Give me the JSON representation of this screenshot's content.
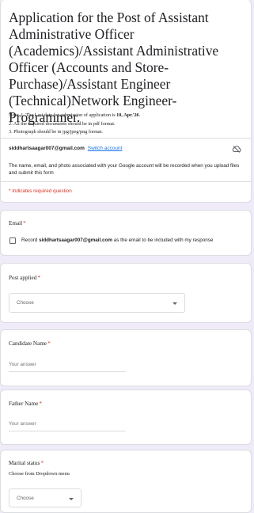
{
  "form": {
    "title": "Application for the Post of Assistant Administrative Officer (Academics)/Assistant Administrative Officer (Accounts and Store-Purchase)/Assistant Engineer (Technical)Network Engineer-Programmer.",
    "note_prefix": "Note: 1. The Last date for submission of application is ",
    "note_date": "10, Apr.'26",
    "note_suffix": ".",
    "note_2": "2. All the required documents should be in pdf format.",
    "note_3": "3. Photograph should be in jpg/jpeg/png format.",
    "account_email": "siddhartsaagar007@gmail.com",
    "switch_account": "Switch account",
    "privacy_text": "The name, email, and photo associated with your Google account will be recorded when you upload files and submit this form",
    "required_note": "* Indicates required question"
  },
  "email_question": {
    "label": "Email",
    "required_mark": "*",
    "record_prefix": "Record ",
    "record_email": "siddhartsaagar007@gmail.com",
    "record_suffix": " as the email to be included with my response"
  },
  "post_applied": {
    "label": "Post applied",
    "required_mark": "*",
    "selected": "Choose"
  },
  "candidate_name": {
    "label": "Candidate Name",
    "required_mark": "*",
    "placeholder": "Your answer"
  },
  "father_name": {
    "label": "Father Name",
    "required_mark": "*",
    "placeholder": "Your answer"
  },
  "marital_status": {
    "label": "Marital status",
    "required_mark": "*",
    "helper": "Choose from Dropdown menu",
    "selected": "Choose"
  },
  "icons": {
    "cloud": "cloud-not-saved-icon",
    "caret": "chevron-down-icon"
  },
  "colors": {
    "background": "#f0ebf8",
    "required": "#d93025",
    "link": "#1a73e8"
  }
}
